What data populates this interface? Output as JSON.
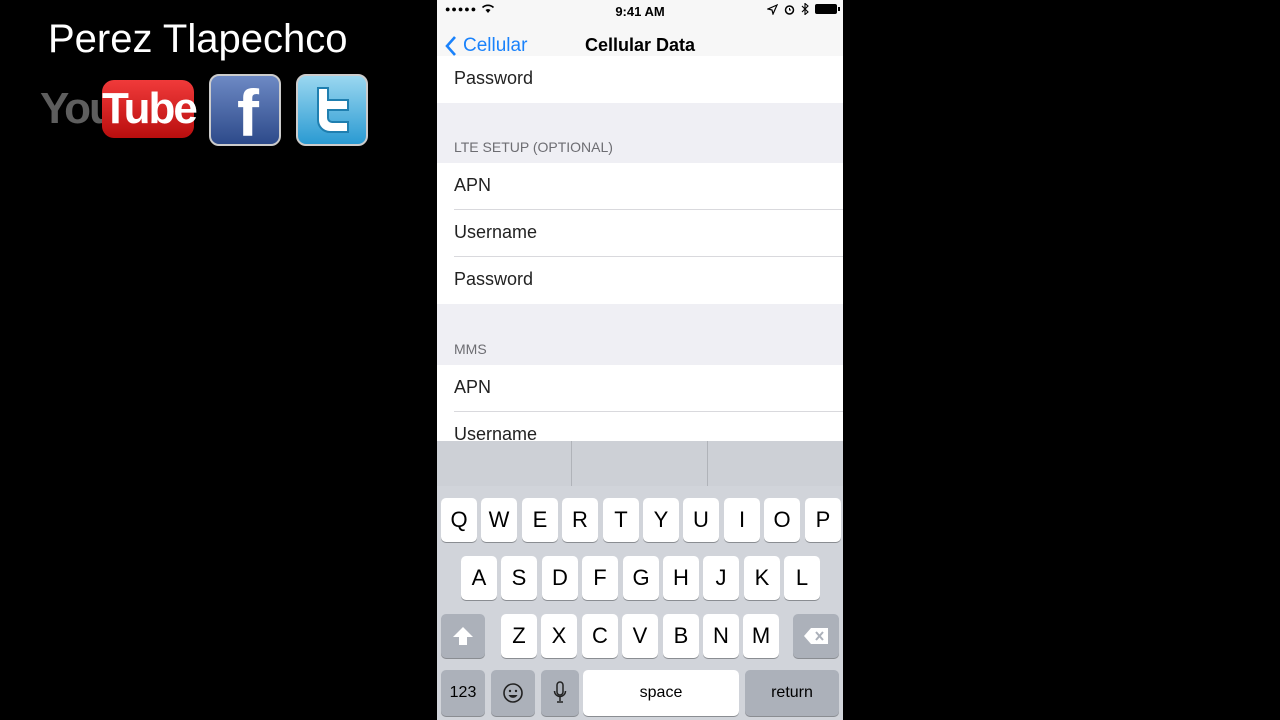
{
  "branding": {
    "channel_name": "Perez Tlapechco",
    "youtube_you": "You",
    "youtube_tube": "Tube",
    "facebook_glyph": "f"
  },
  "status_bar": {
    "time": "9:41 AM",
    "signal_dots": "●●●●●"
  },
  "nav": {
    "back_label": "Cellular",
    "title": "Cellular Data"
  },
  "cells": {
    "top_password": "Password",
    "lte_header": "LTE SETUP (OPTIONAL)",
    "lte_apn": "APN",
    "lte_username": "Username",
    "lte_password": "Password",
    "mms_header": "MMS",
    "mms_apn": "APN",
    "mms_username": "Username"
  },
  "keyboard": {
    "row1": [
      "Q",
      "W",
      "E",
      "R",
      "T",
      "Y",
      "U",
      "I",
      "O",
      "P"
    ],
    "row2": [
      "A",
      "S",
      "D",
      "F",
      "G",
      "H",
      "J",
      "K",
      "L"
    ],
    "row3": [
      "Z",
      "X",
      "C",
      "V",
      "B",
      "N",
      "M"
    ],
    "numbers_label": "123",
    "space_label": "space",
    "return_label": "return"
  },
  "colors": {
    "accent": "#1a82fb",
    "youtube_red": "#d91c1c",
    "facebook_blue": "#3b5998",
    "twitter_blue": "#2a9ad2"
  }
}
